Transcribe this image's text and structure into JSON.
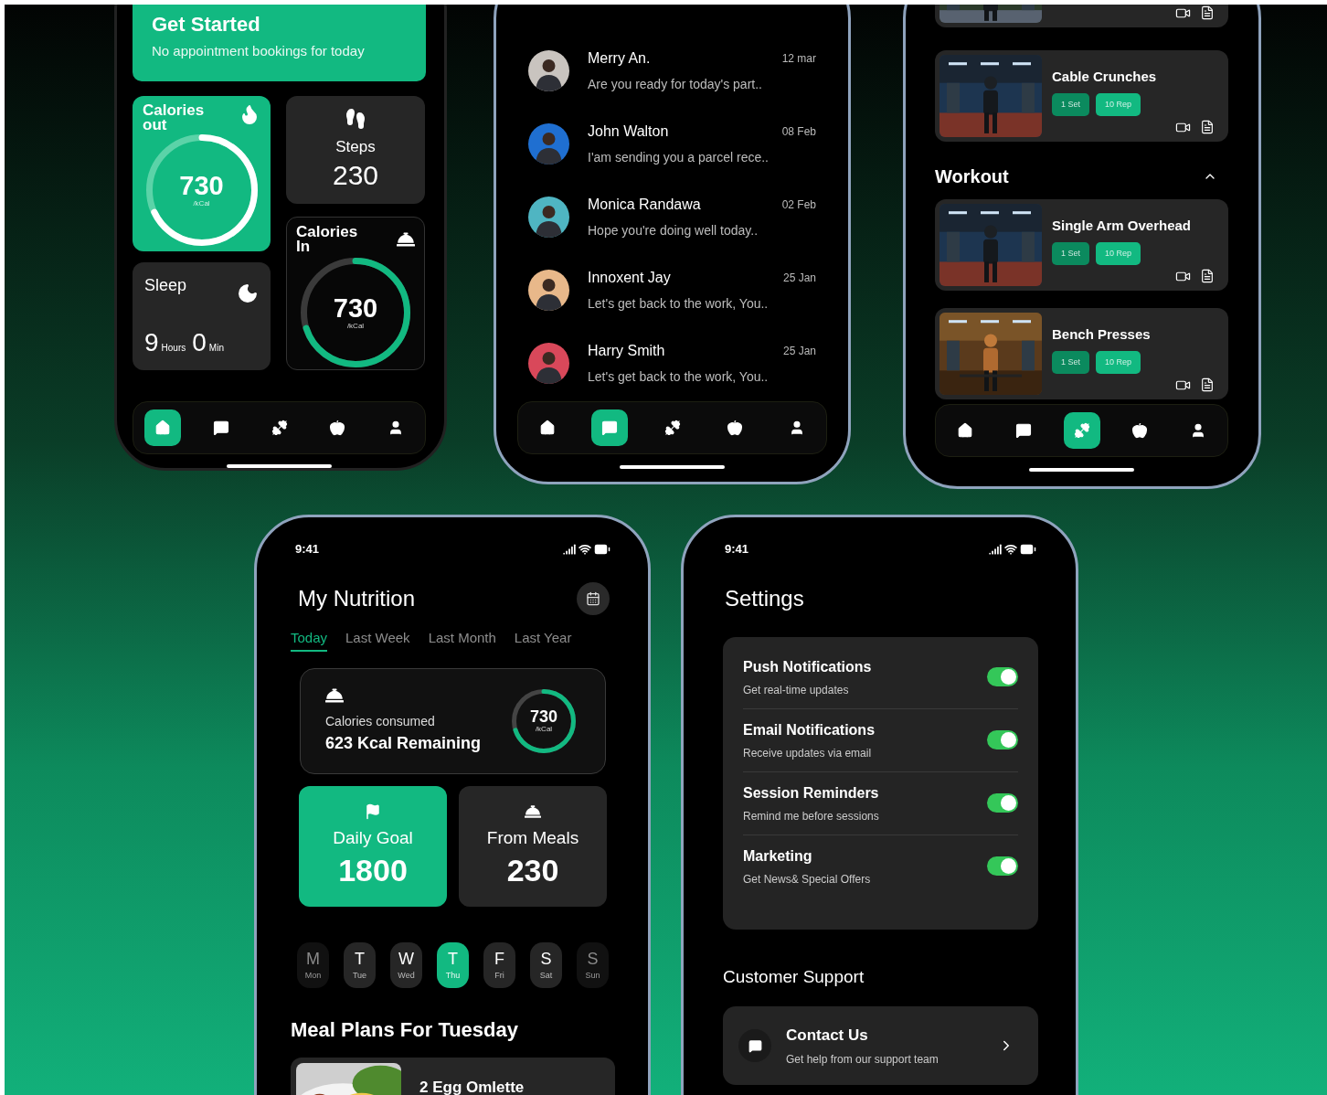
{
  "home": {
    "banner": {
      "title": "Get Started",
      "subtitle": "No appointment bookings for today"
    },
    "calories_out": {
      "label": "Calories out",
      "value": "730",
      "unit": "/kCal",
      "level": 0.68
    },
    "steps": {
      "label": "Steps",
      "value": "230"
    },
    "sleep": {
      "label": "Sleep",
      "hours": "9",
      "hours_unit": "Hours",
      "minutes": "0",
      "minutes_unit": "Min"
    },
    "calories_in": {
      "label": "Calories In",
      "value": "730",
      "unit": "/kCal",
      "level": 0.7
    },
    "nav": [
      {
        "kind": "home",
        "selected": true
      },
      {
        "kind": "chat",
        "selected": false
      },
      {
        "kind": "workout",
        "selected": false
      },
      {
        "kind": "food",
        "selected": false
      },
      {
        "kind": "profile",
        "selected": false
      }
    ]
  },
  "chat": {
    "messages": [
      {
        "name": "Merry An.",
        "date": "12 mar",
        "preview": "Are you ready for today's part..",
        "color": "#c9c4bf"
      },
      {
        "name": "John Walton",
        "date": "08 Feb",
        "preview": "I'am sending you a parcel rece..",
        "color": "#1f6fd1"
      },
      {
        "name": "Monica Randawa",
        "date": "02 Feb",
        "preview": "Hope you're doing well today..",
        "color": "#4fb5c2"
      },
      {
        "name": "Innoxent Jay",
        "date": "25 Jan",
        "preview": "Let's get back to the work, You..",
        "color": "#e8b88a"
      },
      {
        "name": "Harry Smith",
        "date": "25 Jan",
        "preview": "Let's get back to the work, You..",
        "color": "#d9485a"
      }
    ],
    "nav": [
      {
        "kind": "home",
        "selected": false
      },
      {
        "kind": "chat",
        "selected": true
      },
      {
        "kind": "workout",
        "selected": false
      },
      {
        "kind": "food",
        "selected": false
      },
      {
        "kind": "profile",
        "selected": false
      }
    ]
  },
  "workout": {
    "cards": [
      {
        "kind": "cut"
      },
      {
        "kind": "full",
        "title": "Cable Crunches",
        "tags": [
          {
            "kind": "sets",
            "label": "1 Set"
          },
          {
            "kind": "reps",
            "label": "10 Rep"
          }
        ]
      }
    ],
    "section": {
      "title": "Workout",
      "expanded": true,
      "cards": [
        {
          "kind": "full",
          "title": "Single Arm Overhead",
          "tags": [
            {
              "kind": "sets",
              "label": "1 Set"
            },
            {
              "kind": "reps",
              "label": "10 Rep"
            }
          ]
        },
        {
          "kind": "full",
          "title": "Bench Presses",
          "tags": [
            {
              "kind": "sets",
              "label": "1 Set"
            },
            {
              "kind": "reps",
              "label": "10 Rep"
            }
          ]
        }
      ]
    },
    "nav": [
      {
        "kind": "home",
        "selected": false
      },
      {
        "kind": "chat",
        "selected": false
      },
      {
        "kind": "workout",
        "selected": true
      },
      {
        "kind": "food",
        "selected": false
      },
      {
        "kind": "profile",
        "selected": false
      }
    ]
  },
  "nutrition": {
    "time": "9:41",
    "title": "My Nutrition",
    "tabs": [
      {
        "label": "Today",
        "selected": true
      },
      {
        "label": "Last Week",
        "selected": false
      },
      {
        "label": "Last Month",
        "selected": false
      },
      {
        "label": "Last Year",
        "selected": false
      }
    ],
    "summary": {
      "label": "Calories consumed",
      "remaining": "623 Kcal Remaining",
      "value": "730",
      "unit": "/kCal",
      "level": 0.7
    },
    "goal_cards": [
      {
        "kind": "goal",
        "label": "Daily Goal",
        "value": "1800",
        "selected": true
      },
      {
        "kind": "meals",
        "label": "From Meals",
        "value": "230",
        "selected": false
      }
    ],
    "days": [
      {
        "letter": "M",
        "label": "Mon",
        "selected": false,
        "disabled": true
      },
      {
        "letter": "T",
        "label": "Tue",
        "selected": false,
        "disabled": false
      },
      {
        "letter": "W",
        "label": "Wed",
        "selected": false,
        "disabled": false
      },
      {
        "letter": "T",
        "label": "Thu",
        "selected": true,
        "disabled": false
      },
      {
        "letter": "F",
        "label": "Fri",
        "selected": false,
        "disabled": false
      },
      {
        "letter": "S",
        "label": "Sat",
        "selected": false,
        "disabled": false
      },
      {
        "letter": "S",
        "label": "Sun",
        "selected": false,
        "disabled": true
      }
    ],
    "meal_plan": {
      "title": "Meal Plans For Tuesday",
      "meals": [
        {
          "name": "2 Egg Omlette"
        }
      ]
    }
  },
  "settings": {
    "time": "9:41",
    "title": "Settings",
    "toggles": [
      {
        "title": "Push Notifications",
        "subtitle": "Get real-time updates",
        "on": true
      },
      {
        "title": "Email Notifications",
        "subtitle": "Receive updates via email",
        "on": true
      },
      {
        "title": "Session Reminders",
        "subtitle": "Remind me before sessions",
        "on": true
      },
      {
        "title": "Marketing",
        "subtitle": "Get News& Special Offers",
        "on": true
      }
    ],
    "support": {
      "title": "Customer Support",
      "items": [
        {
          "title": "Contact Us",
          "subtitle": "Get help from our support team"
        }
      ]
    }
  }
}
